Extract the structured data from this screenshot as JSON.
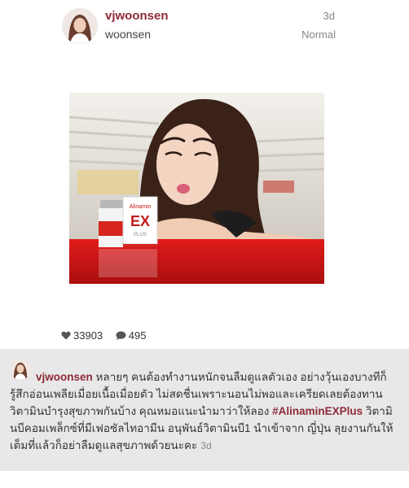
{
  "header": {
    "username": "vjwoonsen",
    "location": "woonsen",
    "time": "3d",
    "filter": "Normal"
  },
  "photo": {
    "product_brand": "Alinamin",
    "product_mark": "EX",
    "product_sub": "PLUS"
  },
  "stats": {
    "likes": "33903",
    "comments": "495",
    "like_icon": "heart-icon",
    "comment_icon": "speech-bubble-icon"
  },
  "caption": {
    "username": "vjwoonsen",
    "text_part1": " หลายๆ คนต้องทำงานหนักจนลืมดูแลตัวเอง อย่างวุ้นเองบางทีก็รู้สึกอ่อนเพลียเมื่อยเนื้อเมื่อยตัว ไม่สดชื่นเพราะนอนไม่พอและเครียดเลยต้องทานวิตามินบำรุงสุขภาพกันบ้าง คุณหมอแนะนำมาว่าให้ลอง ",
    "hashtag": "#AlinaminEXPlus",
    "text_part2": " วิตามินบีคอมเพล็กซ์ที่มีเฟอซัลไทอามีน อนุพันธ์วิตามินบี1 นำเข้าจาก ญี่ปุ่น ลุยงานกันให้เต็มที่แล้วก็อย่าลืมดูแลสุขภาพด้วยนะคะ",
    "time": "3d"
  },
  "colors": {
    "username": "#8e2a37",
    "caption_bg": "#e8e8e8",
    "muted": "#888888"
  }
}
